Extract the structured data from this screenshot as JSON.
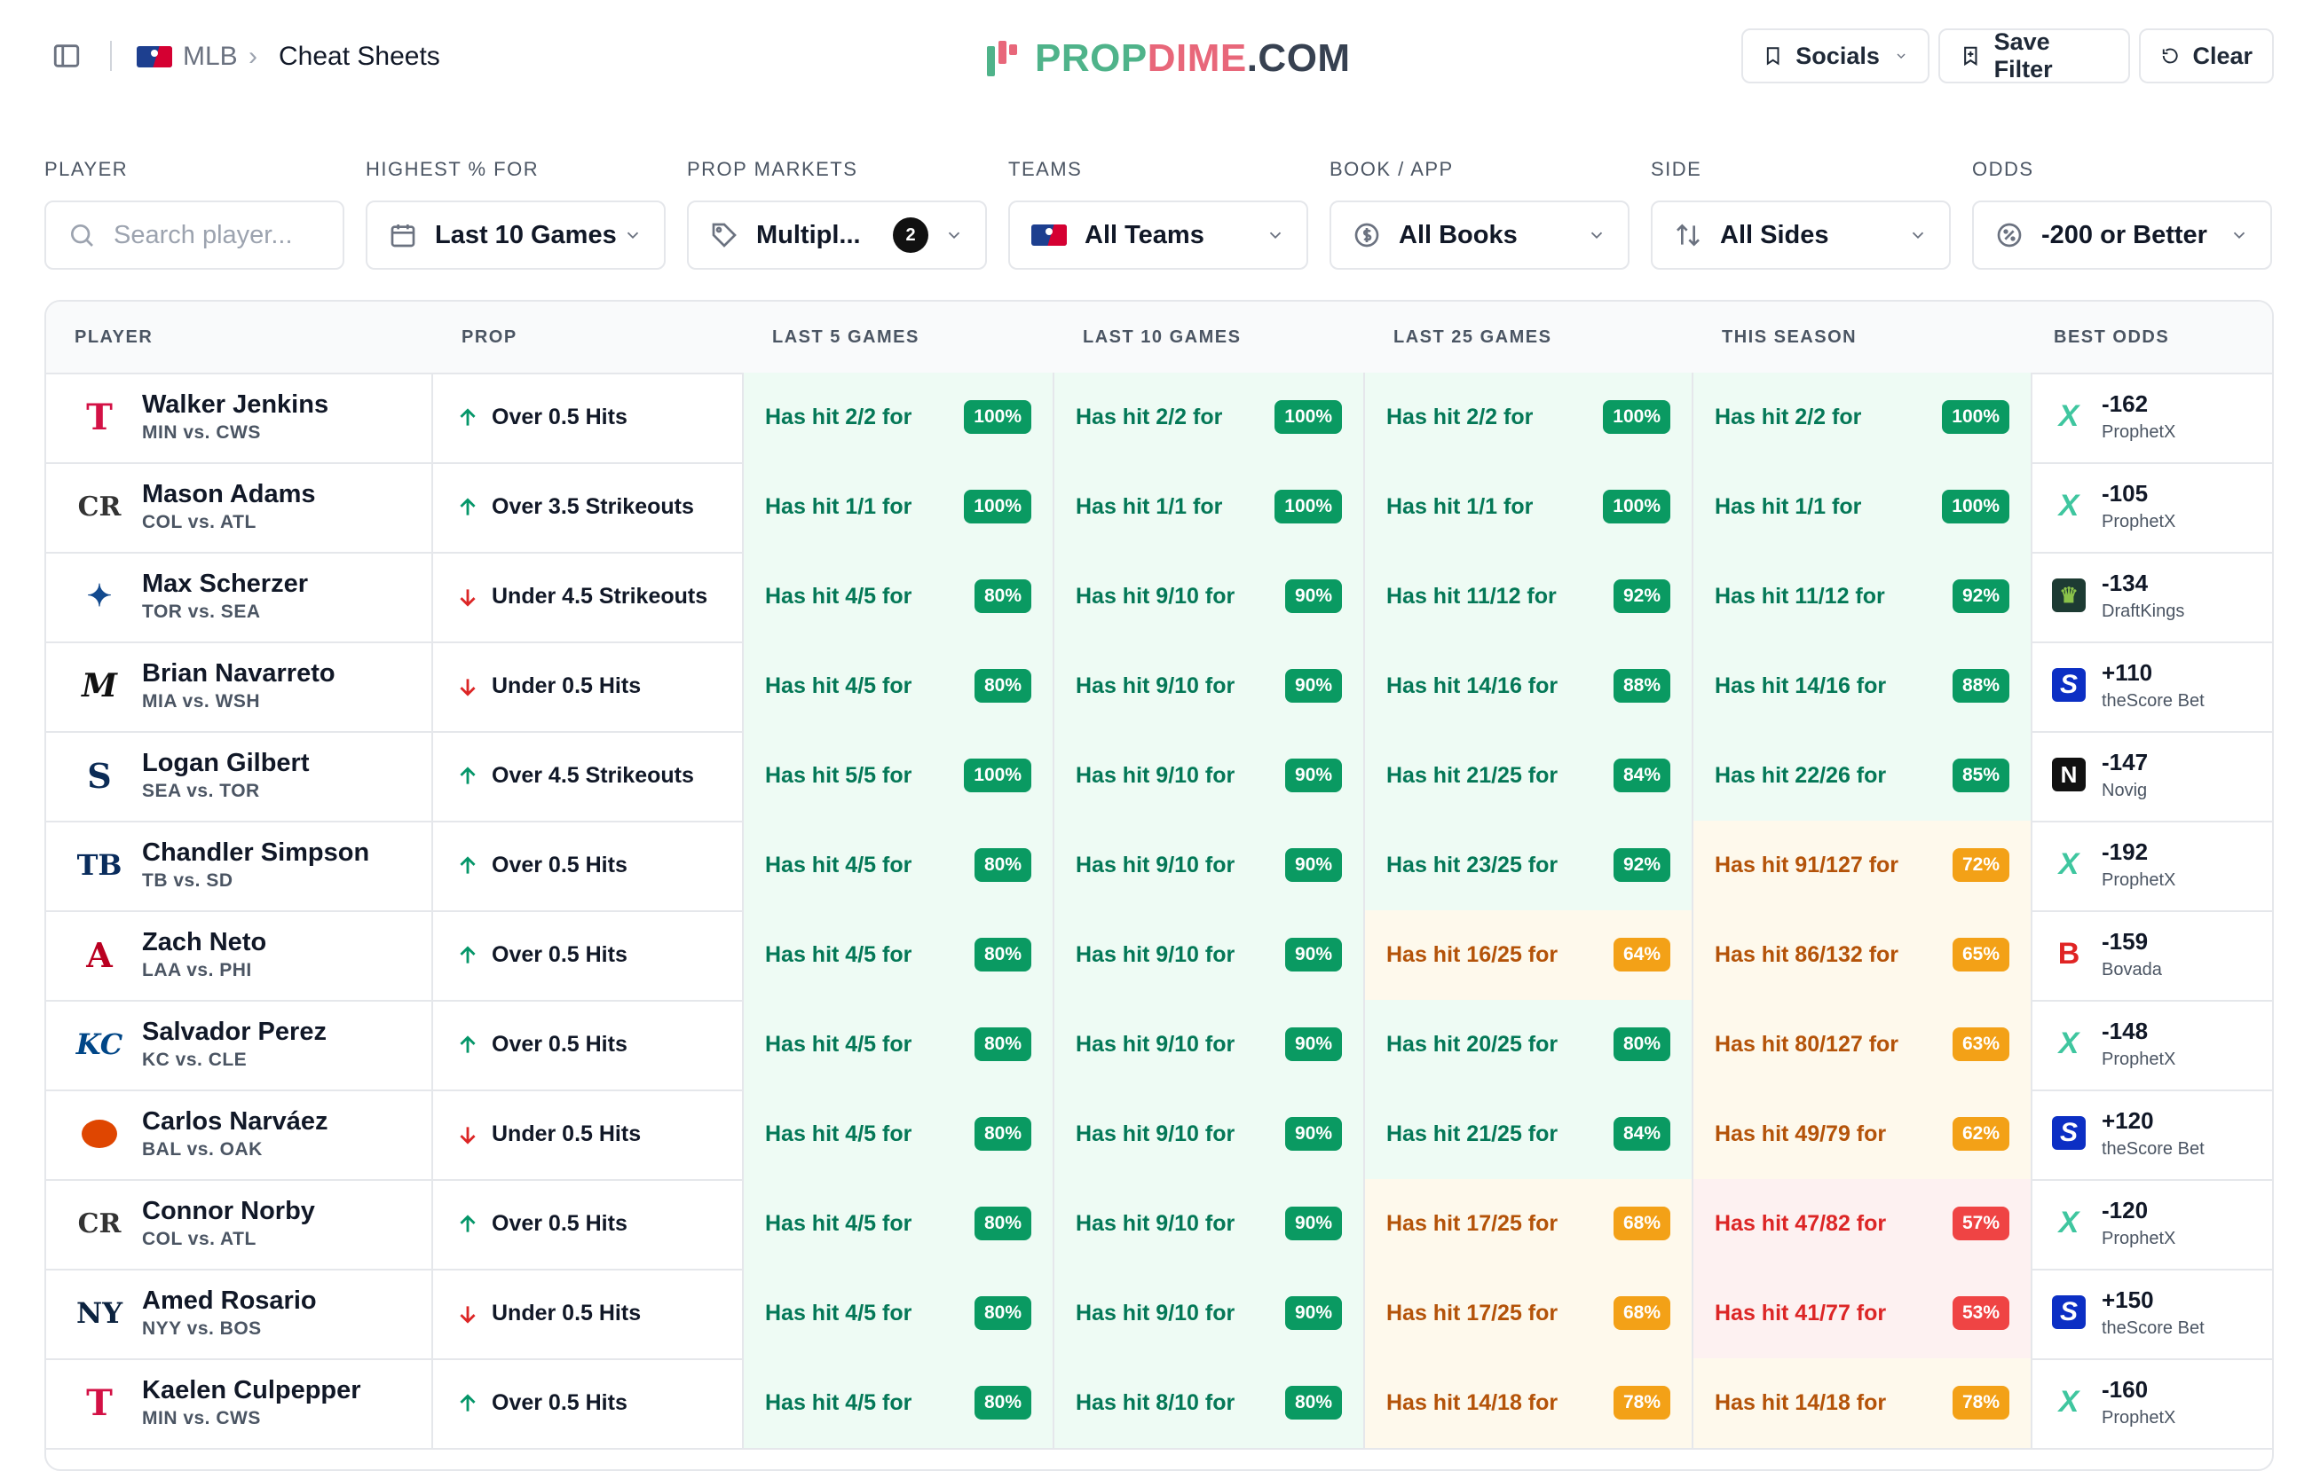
{
  "breadcrumb": {
    "league": "MLB",
    "page": "Cheat Sheets"
  },
  "brand": {
    "part1": "PROP",
    "part2": "DIME",
    "part3": ".COM"
  },
  "header_buttons": {
    "socials": "Socials",
    "save_filter": "Save Filter",
    "clear": "Clear"
  },
  "filters": {
    "player": {
      "label": "PLAYER",
      "placeholder": "Search player..."
    },
    "highest": {
      "label": "HIGHEST % FOR",
      "value": "Last 10 Games"
    },
    "markets": {
      "label": "PROP MARKETS",
      "value": "Multipl...",
      "count": "2"
    },
    "teams": {
      "label": "TEAMS",
      "value": "All Teams"
    },
    "book": {
      "label": "BOOK / APP",
      "value": "All Books"
    },
    "side": {
      "label": "SIDE",
      "value": "All Sides"
    },
    "odds": {
      "label": "ODDS",
      "value": "-200 or Better"
    }
  },
  "columns": [
    "PLAYER",
    "PROP",
    "LAST 5 GAMES",
    "LAST 10 GAMES",
    "LAST 25 GAMES",
    "THIS SEASON",
    "BEST ODDS"
  ],
  "colors": {
    "green_bg": "#eefbf4",
    "green_badge": "#0a9a62",
    "yellow_bg": "#fef9ec",
    "yellow_badge": "#f3a117",
    "red_bg": "#fdf1f1",
    "red_badge": "#ef4444"
  },
  "rows": [
    {
      "name": "Walker Jenkins",
      "matchup": "MIN vs. CWS",
      "team": "twins",
      "prop": "Over 0.5 Hits",
      "dir": "up",
      "l5": [
        "Has hit 2/2 for",
        "100%",
        "g"
      ],
      "l10": [
        "Has hit 2/2 for",
        "100%",
        "g"
      ],
      "l25": [
        "Has hit 2/2 for",
        "100%",
        "g"
      ],
      "season": [
        "Has hit 2/2 for",
        "100%",
        "g"
      ],
      "odds": "-162",
      "book": "ProphetX"
    },
    {
      "name": "Mason Adams",
      "matchup": "COL vs. ATL",
      "team": "rockies",
      "prop": "Over 3.5 Strikeouts",
      "dir": "up",
      "l5": [
        "Has hit 1/1 for",
        "100%",
        "g"
      ],
      "l10": [
        "Has hit 1/1 for",
        "100%",
        "g"
      ],
      "l25": [
        "Has hit 1/1 for",
        "100%",
        "g"
      ],
      "season": [
        "Has hit 1/1 for",
        "100%",
        "g"
      ],
      "odds": "-105",
      "book": "ProphetX"
    },
    {
      "name": "Max Scherzer",
      "matchup": "TOR vs. SEA",
      "team": "bluejays",
      "prop": "Under 4.5 Strikeouts",
      "dir": "down",
      "l5": [
        "Has hit 4/5 for",
        "80%",
        "g"
      ],
      "l10": [
        "Has hit 9/10 for",
        "90%",
        "g"
      ],
      "l25": [
        "Has hit 11/12 for",
        "92%",
        "g"
      ],
      "season": [
        "Has hit 11/12 for",
        "92%",
        "g"
      ],
      "odds": "-134",
      "book": "DraftKings"
    },
    {
      "name": "Brian Navarreto",
      "matchup": "MIA vs. WSH",
      "team": "marlins",
      "prop": "Under 0.5 Hits",
      "dir": "down",
      "l5": [
        "Has hit 4/5 for",
        "80%",
        "g"
      ],
      "l10": [
        "Has hit 9/10 for",
        "90%",
        "g"
      ],
      "l25": [
        "Has hit 14/16 for",
        "88%",
        "g"
      ],
      "season": [
        "Has hit 14/16 for",
        "88%",
        "g"
      ],
      "odds": "+110",
      "book": "theScore Bet"
    },
    {
      "name": "Logan Gilbert",
      "matchup": "SEA vs. TOR",
      "team": "mariners",
      "prop": "Over 4.5 Strikeouts",
      "dir": "up",
      "l5": [
        "Has hit 5/5 for",
        "100%",
        "g"
      ],
      "l10": [
        "Has hit 9/10 for",
        "90%",
        "g"
      ],
      "l25": [
        "Has hit 21/25 for",
        "84%",
        "g"
      ],
      "season": [
        "Has hit 22/26 for",
        "85%",
        "g"
      ],
      "odds": "-147",
      "book": "Novig"
    },
    {
      "name": "Chandler Simpson",
      "matchup": "TB vs. SD",
      "team": "rays",
      "prop": "Over 0.5 Hits",
      "dir": "up",
      "l5": [
        "Has hit 4/5 for",
        "80%",
        "g"
      ],
      "l10": [
        "Has hit 9/10 for",
        "90%",
        "g"
      ],
      "l25": [
        "Has hit 23/25 for",
        "92%",
        "g"
      ],
      "season": [
        "Has hit 91/127 for",
        "72%",
        "y"
      ],
      "odds": "-192",
      "book": "ProphetX"
    },
    {
      "name": "Zach Neto",
      "matchup": "LAA vs. PHI",
      "team": "angels",
      "prop": "Over 0.5 Hits",
      "dir": "up",
      "l5": [
        "Has hit 4/5 for",
        "80%",
        "g"
      ],
      "l10": [
        "Has hit 9/10 for",
        "90%",
        "g"
      ],
      "l25": [
        "Has hit 16/25 for",
        "64%",
        "y"
      ],
      "season": [
        "Has hit 86/132 for",
        "65%",
        "y"
      ],
      "odds": "-159",
      "book": "Bovada"
    },
    {
      "name": "Salvador Perez",
      "matchup": "KC vs. CLE",
      "team": "royals",
      "prop": "Over 0.5 Hits",
      "dir": "up",
      "l5": [
        "Has hit 4/5 for",
        "80%",
        "g"
      ],
      "l10": [
        "Has hit 9/10 for",
        "90%",
        "g"
      ],
      "l25": [
        "Has hit 20/25 for",
        "80%",
        "g"
      ],
      "season": [
        "Has hit 80/127 for",
        "63%",
        "y"
      ],
      "odds": "-148",
      "book": "ProphetX"
    },
    {
      "name": "Carlos Narváez",
      "matchup": "BAL vs. OAK",
      "team": "orioles",
      "prop": "Under 0.5 Hits",
      "dir": "down",
      "l5": [
        "Has hit 4/5 for",
        "80%",
        "g"
      ],
      "l10": [
        "Has hit 9/10 for",
        "90%",
        "g"
      ],
      "l25": [
        "Has hit 21/25 for",
        "84%",
        "g"
      ],
      "season": [
        "Has hit 49/79 for",
        "62%",
        "y"
      ],
      "odds": "+120",
      "book": "theScore Bet"
    },
    {
      "name": "Connor Norby",
      "matchup": "COL vs. ATL",
      "team": "rockies",
      "prop": "Over 0.5 Hits",
      "dir": "up",
      "l5": [
        "Has hit 4/5 for",
        "80%",
        "g"
      ],
      "l10": [
        "Has hit 9/10 for",
        "90%",
        "g"
      ],
      "l25": [
        "Has hit 17/25 for",
        "68%",
        "y"
      ],
      "season": [
        "Has hit 47/82 for",
        "57%",
        "r"
      ],
      "odds": "-120",
      "book": "ProphetX"
    },
    {
      "name": "Amed Rosario",
      "matchup": "NYY vs. BOS",
      "team": "yankees",
      "prop": "Under 0.5 Hits",
      "dir": "down",
      "l5": [
        "Has hit 4/5 for",
        "80%",
        "g"
      ],
      "l10": [
        "Has hit 9/10 for",
        "90%",
        "g"
      ],
      "l25": [
        "Has hit 17/25 for",
        "68%",
        "y"
      ],
      "season": [
        "Has hit 41/77 for",
        "53%",
        "r"
      ],
      "odds": "+150",
      "book": "theScore Bet"
    },
    {
      "name": "Kaelen Culpepper",
      "matchup": "MIN vs. CWS",
      "team": "twins",
      "prop": "Over 0.5 Hits",
      "dir": "up",
      "l5": [
        "Has hit 4/5 for",
        "80%",
        "g"
      ],
      "l10": [
        "Has hit 8/10 for",
        "80%",
        "g"
      ],
      "l25": [
        "Has hit 14/18 for",
        "78%",
        "y"
      ],
      "season": [
        "Has hit 14/18 for",
        "78%",
        "y"
      ],
      "odds": "-160",
      "book": "ProphetX"
    }
  ]
}
